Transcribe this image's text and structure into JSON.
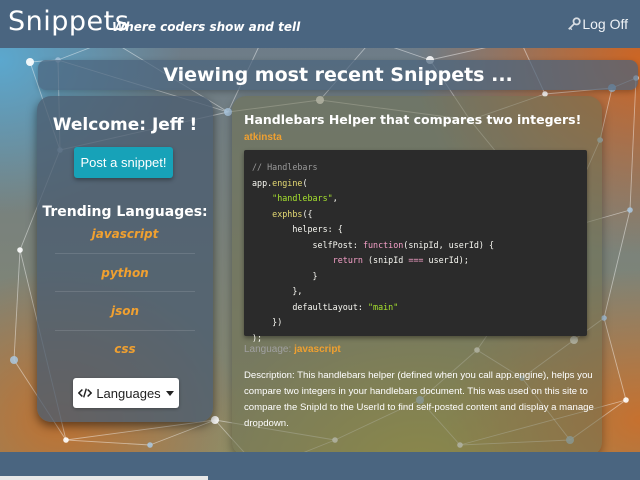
{
  "header": {
    "brand": "Snippets",
    "tagline": "Where coders show and tell",
    "logoff_label": "Log Off",
    "logoff_icon": "key-icon"
  },
  "page_title": "Viewing most recent Snippets ...",
  "sidebar": {
    "welcome": "Welcome: Jeff !",
    "post_button": "Post a snippet!",
    "trending_heading": "Trending Languages:",
    "languages": [
      "javascript",
      "python",
      "json",
      "css"
    ],
    "languages_button": "Languages",
    "languages_button_icon": "code-icon"
  },
  "snippet": {
    "title": "Handlebars Helper that compares two integers!",
    "author": "atkinsta",
    "code_lines": [
      "// Handlebars",
      "app.engine(",
      "    \"handlebars\",",
      "    exphbs({",
      "        helpers: {",
      "            selfPost: function(snipId, userId) {",
      "                return (snipId === userId);",
      "            }",
      "        },",
      "        defaultLayout: \"main\"",
      "    })",
      ");"
    ],
    "language_label": "Language:",
    "language_value": "javascript",
    "description": "Description: This handlebars helper (defined when you call app.engine), helps you compare two integers in your handlebars document. This was used on this site to compare the SnipId to the UserId to find self-posted content and display a manage dropdown."
  },
  "colors": {
    "navbar": "#4a6580",
    "accent_orange": "#f0a030",
    "post_button": "#17a2b8",
    "code_background": "#2b2b2b"
  }
}
